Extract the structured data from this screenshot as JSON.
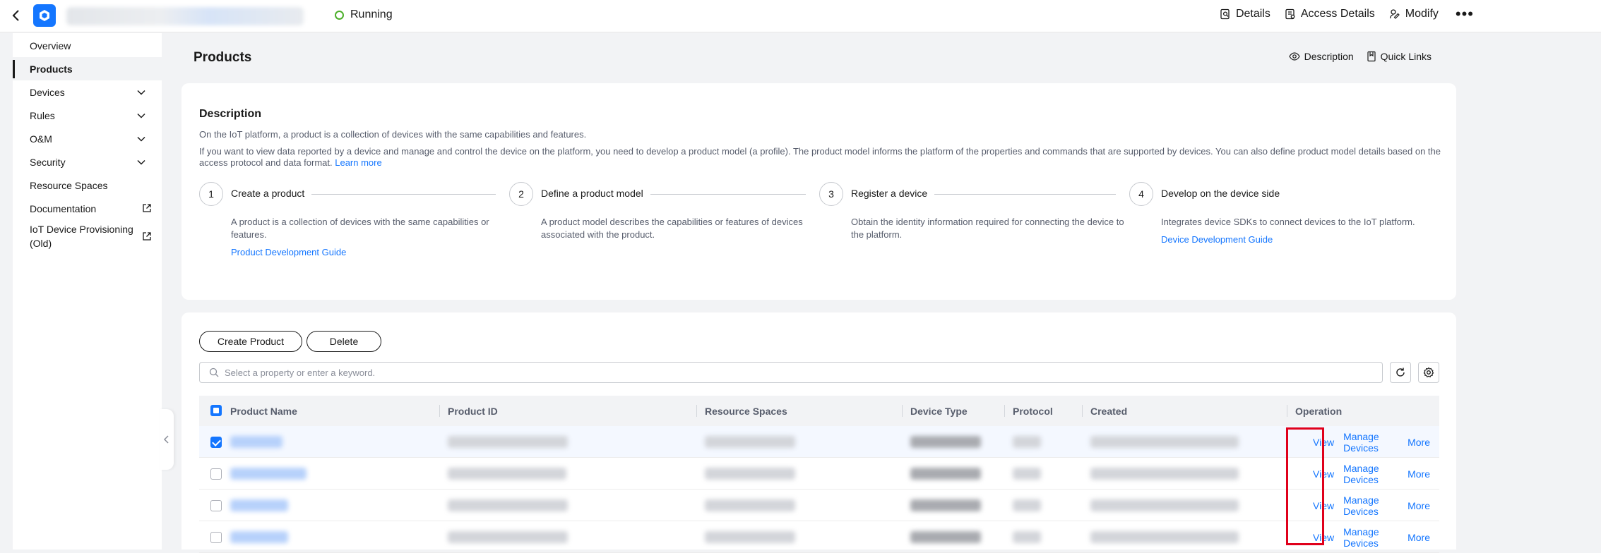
{
  "topbar": {
    "status": "Running",
    "actions": [
      {
        "label": "Details",
        "icon": "details-icon"
      },
      {
        "label": "Access Details",
        "icon": "access-details-icon"
      },
      {
        "label": "Modify",
        "icon": "modify-icon"
      }
    ],
    "more_icon": "more-dots-icon"
  },
  "sidebar": {
    "items": [
      {
        "label": "Overview"
      },
      {
        "label": "Products",
        "active": true
      },
      {
        "label": "Devices",
        "expandable": true
      },
      {
        "label": "Rules",
        "expandable": true
      },
      {
        "label": "O&M",
        "expandable": true
      },
      {
        "label": "Security",
        "expandable": true
      },
      {
        "label": "Resource Spaces"
      },
      {
        "label": "Documentation",
        "external": true
      },
      {
        "label": "IoT Device Provisioning (Old)",
        "external": true
      }
    ]
  },
  "page": {
    "title": "Products",
    "header_links": [
      {
        "label": "Description",
        "icon": "eye-icon"
      },
      {
        "label": "Quick Links",
        "icon": "bookmark-icon"
      }
    ]
  },
  "description": {
    "heading": "Description",
    "para1": "On the IoT platform, a product is a collection of devices with the same capabilities and features.",
    "para2": "If you want to view data reported by a device and manage and control the device on the platform, you need to develop a product model (a profile). The product model informs the platform of the properties and commands that are supported by devices. You can also define product model details based on the access protocol and data format.",
    "learn_more": "Learn more",
    "steps": [
      {
        "num": "1",
        "title": "Create a product",
        "desc": "A product is a collection of devices with the same capabilities or features.",
        "link": "Product Development Guide"
      },
      {
        "num": "2",
        "title": "Define a product model",
        "desc": "A product model describes the capabilities or features of devices associated with the product.",
        "link": ""
      },
      {
        "num": "3",
        "title": "Register a device",
        "desc": "Obtain the identity information required for connecting the device to the platform.",
        "link": ""
      },
      {
        "num": "4",
        "title": "Develop on the device side",
        "desc": "Integrates device SDKs to connect devices to the IoT platform.",
        "link": "Device Development Guide"
      }
    ]
  },
  "toolbar": {
    "create_label": "Create Product",
    "delete_label": "Delete",
    "search_placeholder": "Select a property or enter a keyword."
  },
  "table": {
    "columns": [
      "Product Name",
      "Product ID",
      "Resource Spaces",
      "Device Type",
      "Protocol",
      "Created",
      "Operation"
    ],
    "operations": [
      "View",
      "Manage Devices",
      "More"
    ],
    "rows": [
      {
        "checked": true
      },
      {
        "checked": false
      },
      {
        "checked": false
      },
      {
        "checked": false
      }
    ]
  },
  "colors": {
    "accent": "#1476ff",
    "running": "#4caf2a",
    "highlight": "#e0001b"
  }
}
